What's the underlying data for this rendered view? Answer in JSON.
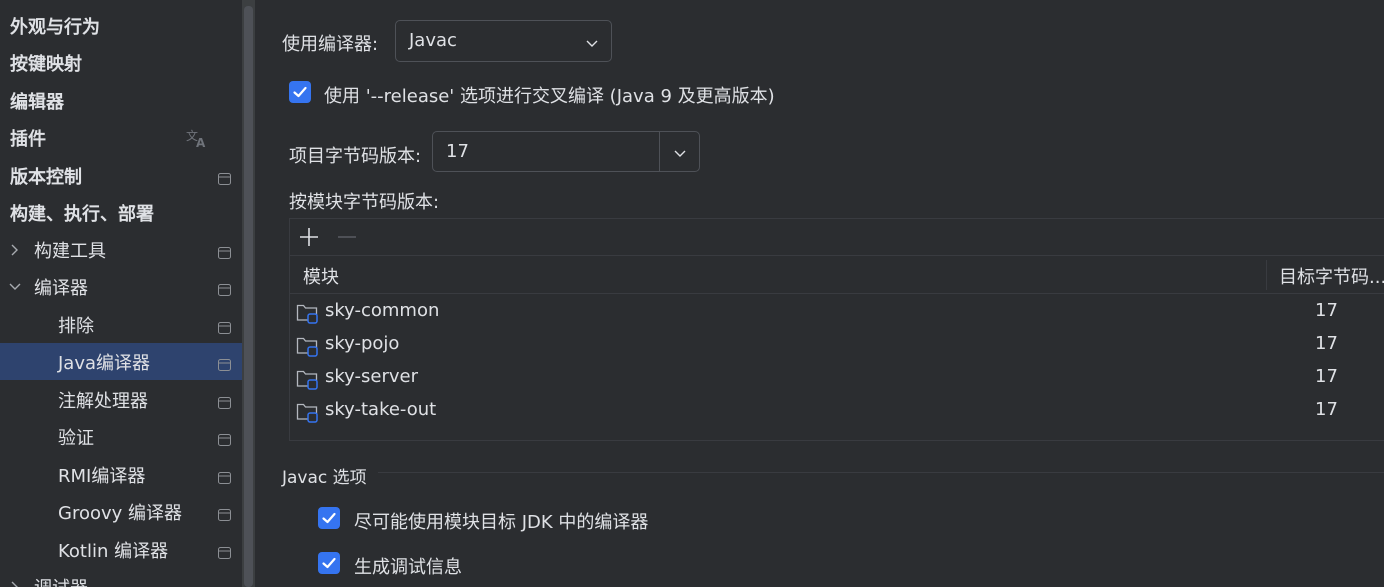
{
  "sidebar": {
    "items": [
      {
        "label": "外观与行为"
      },
      {
        "label": "按键映射"
      },
      {
        "label": "编辑器"
      },
      {
        "label": "插件"
      },
      {
        "label": "版本控制"
      },
      {
        "label": "构建、执行、部署"
      },
      {
        "label": "构建工具"
      },
      {
        "label": "编译器"
      },
      {
        "label": "排除"
      },
      {
        "label": "Java编译器"
      },
      {
        "label": "注解处理器"
      },
      {
        "label": "验证"
      },
      {
        "label": "RMI编译器"
      },
      {
        "label": "Groovy 编译器"
      },
      {
        "label": "Kotlin 编译器"
      },
      {
        "label": "调试器"
      }
    ],
    "selected": "Java编译器"
  },
  "main": {
    "compiler_label": "使用编译器:",
    "compiler_value": "Javac",
    "release_checkbox_label": "使用 '--release' 选项进行交叉编译 (Java 9 及更高版本)",
    "release_checked": true,
    "bytecode_label": "项目字节码版本:",
    "bytecode_value": "17",
    "per_module_label": "按模块字节码版本:",
    "table": {
      "columns": [
        "模块",
        "目标字节码..."
      ],
      "rows": [
        {
          "module": "sky-common",
          "version": "17"
        },
        {
          "module": "sky-pojo",
          "version": "17"
        },
        {
          "module": "sky-server",
          "version": "17"
        },
        {
          "module": "sky-take-out",
          "version": "17"
        }
      ]
    },
    "javac_section_title": "Javac 选项",
    "option_module_jdk": "尽可能使用模块目标 JDK 中的编译器",
    "option_module_jdk_checked": true,
    "option_debug_info": "生成调试信息",
    "option_debug_info_checked": true
  },
  "colors": {
    "background": "#2b2d30",
    "accent": "#3574f0",
    "selection": "#2e436e",
    "text": "#dfe1e5"
  }
}
